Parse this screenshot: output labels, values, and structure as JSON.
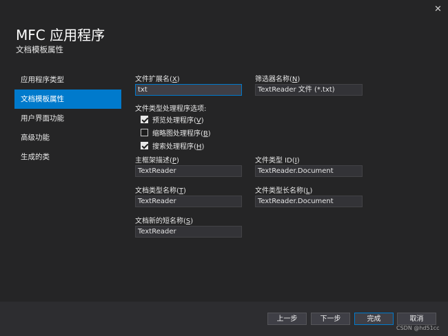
{
  "window": {
    "title": "MFC 应用程序",
    "subtitle": "文档模板属性",
    "close_glyph": "✕"
  },
  "nav": {
    "items": [
      {
        "label": "应用程序类型"
      },
      {
        "label": "文档模板属性",
        "active": true
      },
      {
        "label": "用户界面功能"
      },
      {
        "label": "高级功能"
      },
      {
        "label": "生成的类"
      }
    ]
  },
  "form": {
    "file_ext": {
      "label_pre": "文件扩展名(",
      "key": "X",
      "label_post": ")",
      "value": "txt"
    },
    "filter_name": {
      "label_pre": "筛选器名称(",
      "key": "N",
      "label_post": ")",
      "value": "TextReader 文件 (*.txt)"
    },
    "handler_options": {
      "label": "文件类型处理程序选项:",
      "items": [
        {
          "label_pre": "预览处理程序(",
          "key": "V",
          "label_post": ")",
          "checked": true
        },
        {
          "label_pre": "缩略图处理程序(",
          "key": "B",
          "label_post": ")",
          "checked": false
        },
        {
          "label_pre": "搜索处理程序(",
          "key": "H",
          "label_post": ")",
          "checked": true
        }
      ]
    },
    "main_frame_caption": {
      "label_pre": "主框架描述(",
      "key": "P",
      "label_post": ")",
      "value": "TextReader"
    },
    "file_type_id": {
      "label_pre": "文件类型 ID(",
      "key": "I",
      "label_post": ")",
      "value": "TextReader.Document"
    },
    "doc_type_name": {
      "label_pre": "文档类型名称(",
      "key": "T",
      "label_post": ")",
      "value": "TextReader"
    },
    "file_type_long_name": {
      "label_pre": "文件类型长名称(",
      "key": "L",
      "label_post": ")",
      "value": "TextReader.Document"
    },
    "new_short_name": {
      "label_pre": "文档新的短名称(",
      "key": "S",
      "label_post": ")",
      "value": "TextReader"
    }
  },
  "footer": {
    "prev_label": "上一步",
    "next_label": "下一步",
    "finish_label": "完成",
    "cancel_label": "取消"
  },
  "watermark": "CSDN @hd51cc",
  "colors": {
    "accent": "#007acc",
    "background": "#252526"
  }
}
